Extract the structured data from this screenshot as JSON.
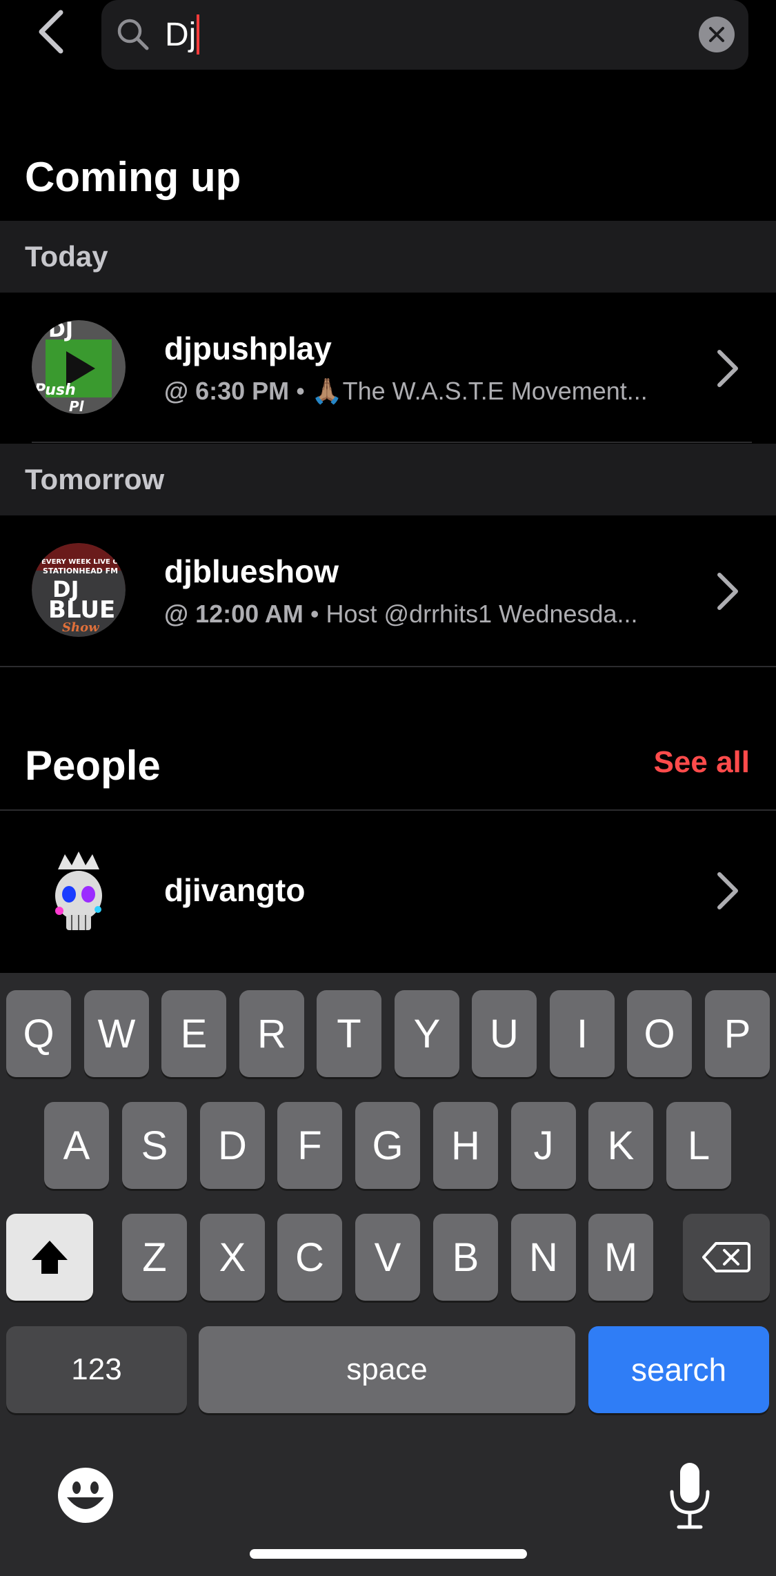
{
  "search": {
    "value": "Dj"
  },
  "coming_up": {
    "title": "Coming up",
    "groups": [
      {
        "day": "Today",
        "item": {
          "name": "djpushplay",
          "time": "@ 6:30 PM",
          "separator": "•",
          "description": "🙏🏽The W.A.S.T.E Movement..."
        }
      },
      {
        "day": "Tomorrow",
        "item": {
          "name": "djblueshow",
          "time": "@ 12:00 AM",
          "separator": "•",
          "description": "Host @drrhits1  Wednesda..."
        }
      }
    ]
  },
  "people": {
    "title": "People",
    "see_all": "See all",
    "items": [
      {
        "name": "djivangto"
      }
    ]
  },
  "keyboard": {
    "row1": [
      "Q",
      "W",
      "E",
      "R",
      "T",
      "Y",
      "U",
      "I",
      "O",
      "P"
    ],
    "row2": [
      "A",
      "S",
      "D",
      "F",
      "G",
      "H",
      "J",
      "K",
      "L"
    ],
    "row3": [
      "Z",
      "X",
      "C",
      "V",
      "B",
      "N",
      "M"
    ],
    "numbers": "123",
    "space": "space",
    "search": "search"
  },
  "colors": {
    "accent": "#ff4b4b",
    "search_key": "#2f7df6",
    "background": "#000000",
    "section_bg": "#1c1c1e"
  }
}
